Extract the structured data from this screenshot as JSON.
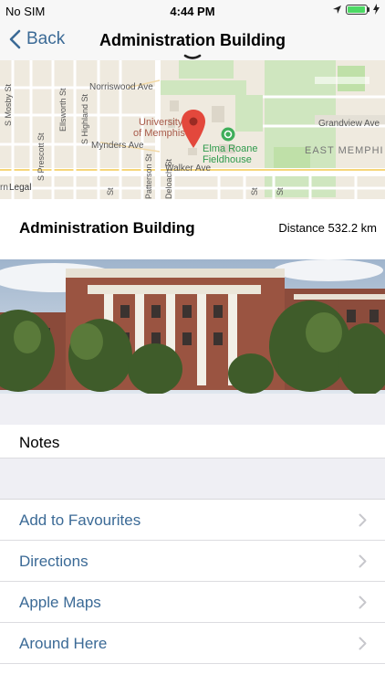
{
  "status_bar": {
    "carrier": "No SIM",
    "time": "4:44 PM",
    "battery_level": 0.95,
    "battery_color": "#4cd964"
  },
  "nav": {
    "back_label": "Back",
    "title": "Administration Building",
    "back_icon": "chevron-left-icon",
    "handle_icon": "chevron-down-icon"
  },
  "map": {
    "labels": {
      "norriswood": "Norriswood Ave",
      "university_1": "University",
      "university_2": "of Memphis",
      "mynders": "Mynders Ave",
      "elma_1": "Elma Roane",
      "elma_2": "Fieldhouse",
      "grandview": "Grandview Ave",
      "east_memphis": "EAST MEMPHI",
      "walker": "Walker Ave",
      "legal": "Legal",
      "ellsworth": "Ellsworth St",
      "prescott": "S Prescott St",
      "highland": "S Highland St",
      "patterson": "Patterson St",
      "deloach": "Deloach St",
      "left_st": "S Mosby St",
      "st_bottom_1": "rn",
      "st_bottom_2": "St",
      "st_bottom_3": "St",
      "st_bottom_4": "St"
    },
    "pin_icon": "map-pin-icon",
    "pin_color": "#e3483c",
    "poi_icon": "stadium-icon",
    "poi_color": "#3fae5a"
  },
  "details": {
    "title": "Administration Building",
    "distance": "Distance 532.2 km"
  },
  "notes_label": "Notes",
  "actions": [
    {
      "label": "Add to Favourites",
      "icon": "chevron-right-icon"
    },
    {
      "label": "Directions",
      "icon": "chevron-right-icon"
    },
    {
      "label": "Apple Maps",
      "icon": "chevron-right-icon"
    },
    {
      "label": "Around Here",
      "icon": "chevron-right-icon"
    }
  ],
  "colors": {
    "accent": "#3b6a96",
    "group_bg": "#efeff4",
    "bar_bg": "#f7f7f7"
  }
}
